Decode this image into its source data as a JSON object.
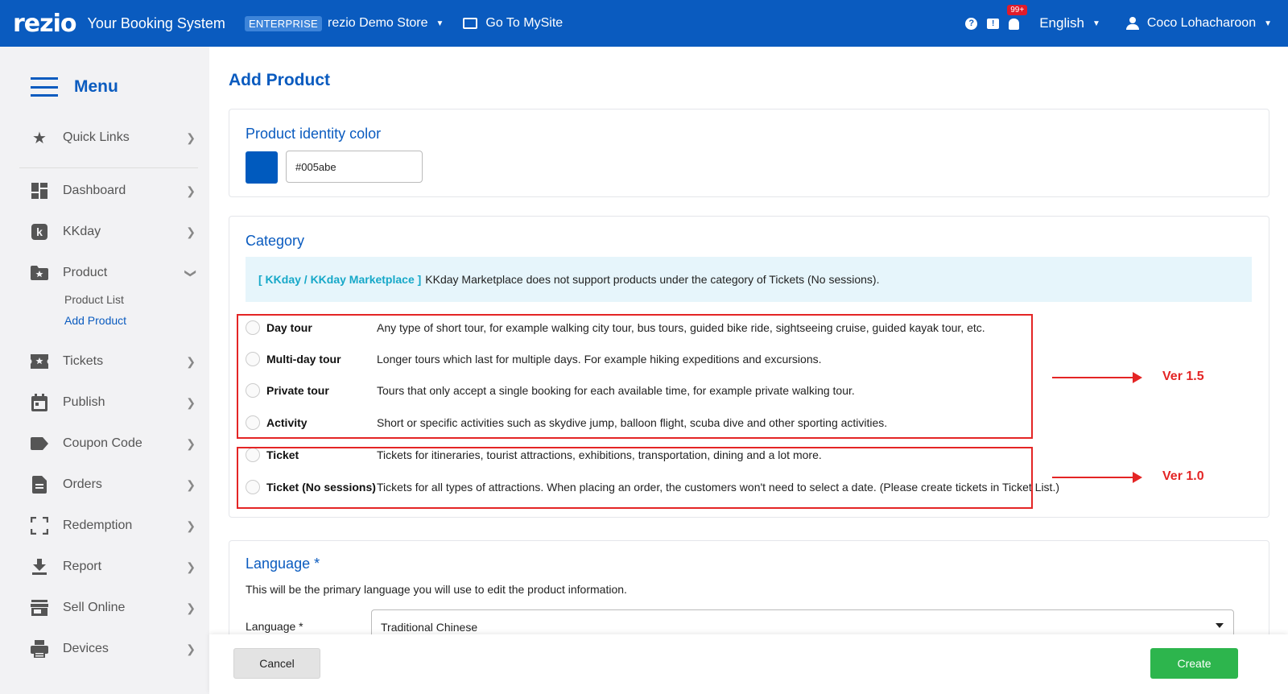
{
  "topbar": {
    "logo": "rezio",
    "app_title": "Your Booking System",
    "plan_badge": "ENTERPRISE",
    "store_name": "rezio Demo Store",
    "mysite_label": "Go To MySite",
    "notification_count": "99+",
    "language": "English",
    "user_name": "Coco Lohacharoon"
  },
  "sidebar": {
    "menu_title": "Menu",
    "items": [
      {
        "label": "Quick Links",
        "icon": "star-icon"
      },
      {
        "label": "Dashboard",
        "icon": "dashboard-icon"
      },
      {
        "label": "KKday",
        "icon": "kkday-icon"
      },
      {
        "label": "Product",
        "icon": "product-folder-icon",
        "expanded": true
      },
      {
        "label": "Tickets",
        "icon": "ticket-icon"
      },
      {
        "label": "Publish",
        "icon": "calendar-icon"
      },
      {
        "label": "Coupon Code",
        "icon": "tag-icon"
      },
      {
        "label": "Orders",
        "icon": "document-icon"
      },
      {
        "label": "Redemption",
        "icon": "scan-icon"
      },
      {
        "label": "Report",
        "icon": "download-icon"
      },
      {
        "label": "Sell Online",
        "icon": "store-icon"
      },
      {
        "label": "Devices",
        "icon": "printer-icon"
      }
    ],
    "product_sub": [
      {
        "label": "Product List",
        "active": false
      },
      {
        "label": "Add Product",
        "active": true
      }
    ]
  },
  "main": {
    "page_title": "Add Product",
    "identity": {
      "title": "Product identity color",
      "color_value": "#005abe",
      "color_text": "#005abe"
    },
    "category": {
      "title": "Category",
      "notice_tag": "[ KKday / KKday Marketplace ]",
      "notice_text": "KKday Marketplace does not support products under the category of Tickets (No sessions).",
      "options": [
        {
          "name": "Day tour",
          "desc": "Any type of short tour, for example walking city tour, bus tours, guided bike ride, sightseeing cruise, guided kayak tour, etc."
        },
        {
          "name": "Multi-day tour",
          "desc": "Longer tours which last for multiple days. For example hiking expeditions and excursions."
        },
        {
          "name": "Private tour",
          "desc": "Tours that only accept a single booking for each available time, for example private walking tour."
        },
        {
          "name": "Activity",
          "desc": "Short or specific activities such as skydive jump, balloon flight, scuba dive and other sporting activities."
        },
        {
          "name": "Ticket",
          "desc": "Tickets for itineraries, tourist attractions, exhibitions, transportation, dining and a lot more."
        },
        {
          "name": "Ticket (No sessions)",
          "desc": "Tickets for all types of attractions. When placing an order, the customers won't need to select a date. (Please create tickets in Ticket List.)"
        }
      ],
      "annotations": {
        "group1": "Ver 1.5",
        "group2": "Ver 1.0"
      }
    },
    "language": {
      "title": "Language *",
      "description": "This will be the primary language you will use to edit the product information.",
      "field_label": "Language *",
      "selected": "Traditional Chinese"
    }
  },
  "actions": {
    "cancel": "Cancel",
    "create": "Create"
  },
  "colors": {
    "brand": "#0a5bbf",
    "create": "#2db54d",
    "annotation": "#e42525"
  }
}
